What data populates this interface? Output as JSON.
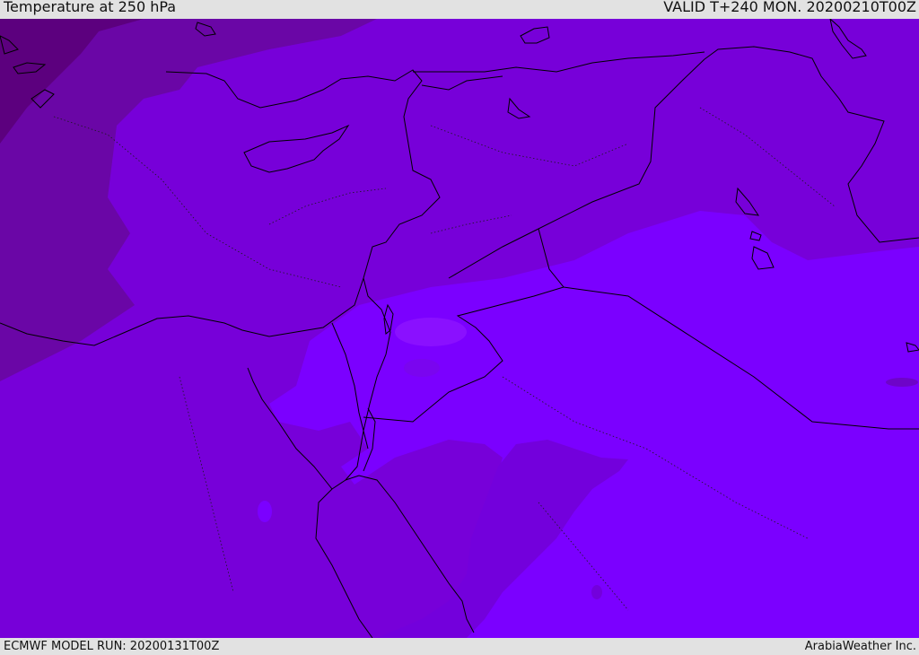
{
  "header": {
    "title": "Temperature at 250 hPa",
    "valid": "VALID T+240 MON. 20200210T00Z"
  },
  "footer": {
    "model_run": "ECMWF MODEL RUN: 20200131T00Z",
    "credit": "ArabiaWeather Inc."
  },
  "map": {
    "field": "temperature",
    "level": "250 hPa",
    "colors": {
      "darkest": "#5c007e",
      "dark": "#6a06a6",
      "mid": "#7700d9",
      "light": "#7b00ff",
      "lightest": "#8a10ff",
      "border": "#000000"
    }
  }
}
